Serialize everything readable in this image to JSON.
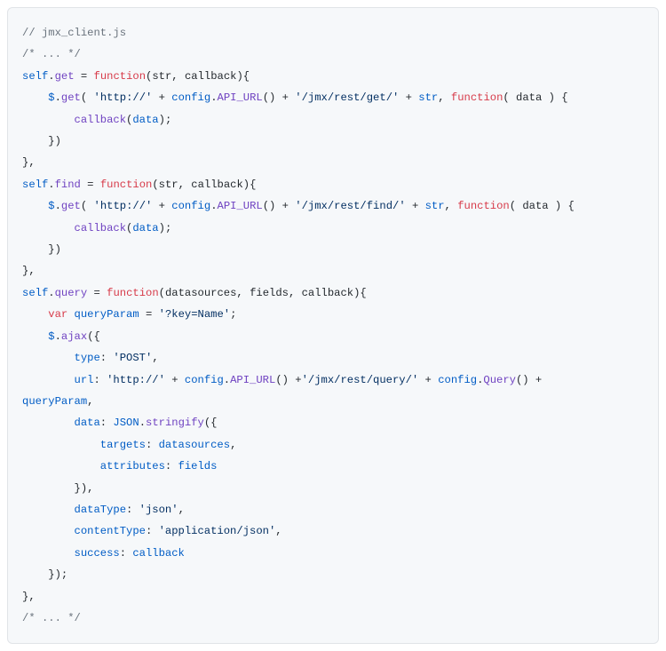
{
  "code": {
    "c1": "// jmx_client.js",
    "c2": "/* ... */",
    "l3_self": "self",
    "l3_dot": ".",
    "l3_get": "get",
    "l3_eq": " = ",
    "l3_fn": "function",
    "l3_lp": "(",
    "l3_p1": "str",
    "l3_cm": ", ",
    "l3_p2": "callback",
    "l3_rp": "){",
    "l4_ind": "    ",
    "l4_jq": "$",
    "l4_d1": ".",
    "l4_get": "get",
    "l4_lp": "( ",
    "l4_s1": "'http://'",
    "l4_pl1": " + ",
    "l4_cfg": "config",
    "l4_d2": ".",
    "l4_api": "API_URL",
    "l4_call": "() + ",
    "l4_s2": "'/jmx/rest/get/'",
    "l4_pl2": " + ",
    "l4_str": "str",
    "l4_cm": ", ",
    "l4_fn": "function",
    "l4_lp2": "( ",
    "l4_data": "data",
    "l4_rp2": " ) {",
    "l5_ind": "        ",
    "l5_cb": "callback",
    "l5_lp": "(",
    "l5_d": "data",
    "l5_rp": ");",
    "l6_ind": "    ",
    "l6_cl": "})",
    "l7_cl": "},",
    "l8_self": "self",
    "l8_dot": ".",
    "l8_find": "find",
    "l8_eq": " = ",
    "l8_fn": "function",
    "l8_lp": "(",
    "l8_p1": "str",
    "l8_cm": ", ",
    "l8_p2": "callback",
    "l8_rp": "){",
    "l9_ind": "    ",
    "l9_jq": "$",
    "l9_d1": ".",
    "l9_get": "get",
    "l9_lp": "( ",
    "l9_s1": "'http://'",
    "l9_pl1": " + ",
    "l9_cfg": "config",
    "l9_d2": ".",
    "l9_api": "API_URL",
    "l9_call": "() + ",
    "l9_s2": "'/jmx/rest/find/'",
    "l9_pl2": " + ",
    "l9_str": "str",
    "l9_cm": ", ",
    "l9_fn": "function",
    "l9_lp2": "( ",
    "l9_data": "data",
    "l9_rp2": " ) {",
    "l10_ind": "        ",
    "l10_cb": "callback",
    "l10_lp": "(",
    "l10_d": "data",
    "l10_rp": ");",
    "l11_ind": "    ",
    "l11_cl": "})",
    "l12_cl": "},",
    "l13_self": "self",
    "l13_dot": ".",
    "l13_query": "query",
    "l13_eq": " = ",
    "l13_fn": "function",
    "l13_lp": "(",
    "l13_p1": "datasources",
    "l13_cm1": ", ",
    "l13_p2": "fields",
    "l13_cm2": ", ",
    "l13_p3": "callback",
    "l13_rp": "){",
    "l14_ind": "    ",
    "l14_var": "var",
    "l14_sp": " ",
    "l14_qp": "queryParam",
    "l14_eq": " = ",
    "l14_s": "'?key=Name'",
    "l14_sc": ";",
    "l15_ind": "    ",
    "l15_jq": "$",
    "l15_d": ".",
    "l15_ajax": "ajax",
    "l15_lp": "({",
    "l16_ind": "        ",
    "l16_type": "type",
    "l16_c": ": ",
    "l16_s": "'POST'",
    "l16_cm": ",",
    "l17_ind": "        ",
    "l17_url": "url",
    "l17_c": ": ",
    "l17_s1": "'http://'",
    "l17_pl1": " + ",
    "l17_cfg": "config",
    "l17_d1": ".",
    "l17_api": "API_URL",
    "l17_call1": "() +",
    "l17_s2": "'/jmx/rest/query/'",
    "l17_pl2": " + ",
    "l17_cfg2": "config",
    "l17_d2": ".",
    "l17_q": "Query",
    "l17_call2": "() + ",
    "l18_qp": "queryParam",
    "l18_cm": ",",
    "l19_ind": "        ",
    "l19_data": "data",
    "l19_c": ": ",
    "l19_json": "JSON",
    "l19_d": ".",
    "l19_str": "stringify",
    "l19_lp": "({",
    "l20_ind": "            ",
    "l20_tg": "targets",
    "l20_c": ": ",
    "l20_ds": "datasources",
    "l20_cm": ",",
    "l21_ind": "            ",
    "l21_attr": "attributes",
    "l21_c": ": ",
    "l21_f": "fields",
    "l22_ind": "        ",
    "l22_cl": "}),",
    "l23_ind": "        ",
    "l23_dt": "dataType",
    "l23_c": ": ",
    "l23_s": "'json'",
    "l23_cm": ",",
    "l24_ind": "        ",
    "l24_ct": "contentType",
    "l24_c": ": ",
    "l24_s": "'application/json'",
    "l24_cm": ",",
    "l25_ind": "        ",
    "l25_suc": "success",
    "l25_c": ": ",
    "l25_cb": "callback",
    "l26_ind": "    ",
    "l26_cl": "});",
    "l27_cl": "},",
    "c28": "/* ... */"
  }
}
